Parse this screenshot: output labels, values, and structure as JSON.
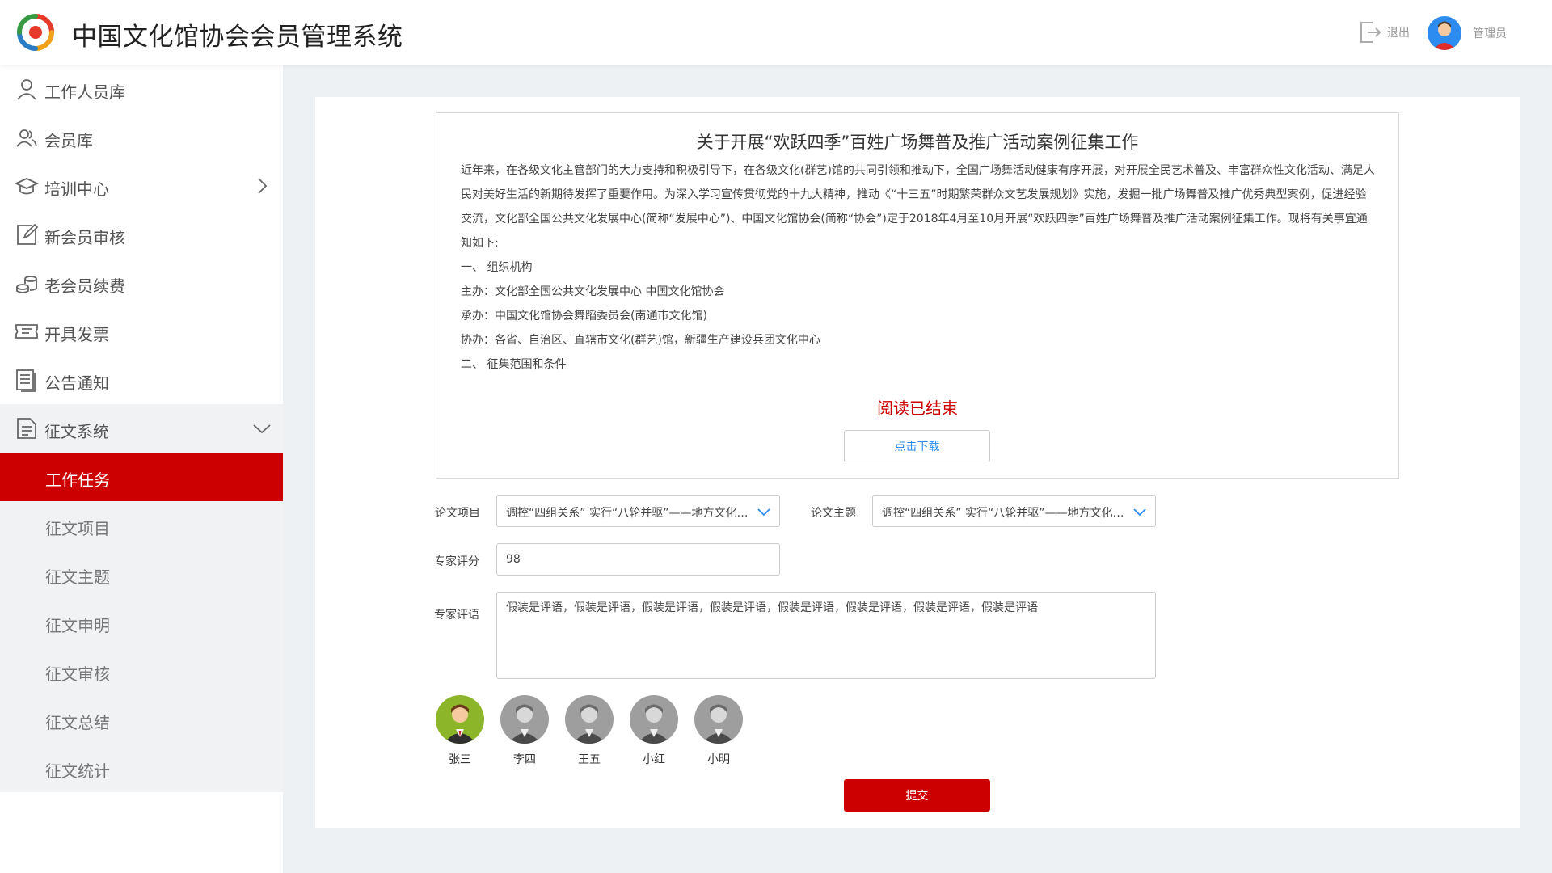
{
  "header": {
    "app_title": "中国文化馆协会会员管理系统",
    "logout_label": "退出",
    "user_name": "管理员"
  },
  "sidebar": {
    "items": [
      {
        "label": "工作人员库",
        "icon": "person-icon"
      },
      {
        "label": "会员库",
        "icon": "people-icon"
      },
      {
        "label": "培训中心",
        "icon": "graduation-cap-icon"
      },
      {
        "label": "新会员审核",
        "icon": "edit-icon"
      },
      {
        "label": "老会员续费",
        "icon": "coins-icon"
      },
      {
        "label": "开具发票",
        "icon": "ticket-icon"
      },
      {
        "label": "公告通知",
        "icon": "document-icon"
      },
      {
        "label": "征文系统",
        "icon": "file-icon"
      }
    ],
    "submenu": [
      {
        "label": "工作任务",
        "active": true
      },
      {
        "label": "征文项目"
      },
      {
        "label": "征文主题"
      },
      {
        "label": "征文申明"
      },
      {
        "label": "征文审核"
      },
      {
        "label": "征文总结"
      },
      {
        "label": "征文统计"
      }
    ]
  },
  "notice": {
    "title": "关于开展“欢跃四季”百姓广场舞普及推广活动案例征集工作",
    "paragraph": "近年来，在各级文化主管部门的大力支持和积极引导下，在各级文化(群艺)馆的共同引领和推动下，全国广场舞活动健康有序开展，对开展全民艺术普及、丰富群众性文化活动、满足人民对美好生活的新期待发挥了重要作用。为深入学习宣传贯彻党的十九大精神，推动《“十三五”时期繁荣群众文艺发展规划》实施，发掘一批广场舞普及推广优秀典型案例，促进经验交流，文化部全国公共文化发展中心(简称“发展中心”)、中国文化馆协会(简称“协会”)定于2018年4月至10月开展“欢跃四季”百姓广场舞普及推广活动案例征集工作。现将有关事宜通知如下:",
    "lines": [
      "一、 组织机构",
      "主办：文化部全国公共文化发展中心  中国文化馆协会",
      "承办：中国文化馆协会舞蹈委员会(南通市文化馆)",
      "协办：各省、自治区、直辖市文化(群艺)馆，新疆生产建设兵团文化中心",
      "二、 征集范围和条件"
    ],
    "read_end": "阅读已结束",
    "download_label": "点击下载"
  },
  "form": {
    "project_label": "论文项目",
    "project_value": "调控“四组关系” 实行“八轮并驱”——地方文化馆发展新思路",
    "theme_label": "论文主题",
    "theme_value": "调控“四组关系” 实行“八轮并驱”——地方文化馆发展新思路",
    "score_label": "专家评分",
    "score_value": "98",
    "comment_label": "专家评语",
    "comment_value": "假装是评语，假装是评语，假装是评语，假装是评语，假装是评语，假装是评语，假装是评语，假装是评语"
  },
  "experts": [
    {
      "name": "张三",
      "selected": true
    },
    {
      "name": "李四"
    },
    {
      "name": "王五"
    },
    {
      "name": "小红"
    },
    {
      "name": "小明"
    }
  ],
  "submit_label": "提交",
  "colors": {
    "accent": "#cc0000",
    "link": "#2d8cf0",
    "selected_avatar_bg": "#8cb52a",
    "default_avatar_bg": "#9e9e9e"
  }
}
